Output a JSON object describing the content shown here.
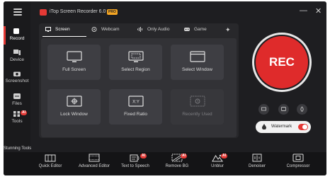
{
  "app": {
    "title": "iTop Screen Recorder 6.0",
    "badge": "PRO"
  },
  "window_controls": {
    "minimize": "—",
    "close": "✕"
  },
  "sidebar": {
    "items": [
      {
        "label": "Record",
        "icon": "record-icon",
        "active": true
      },
      {
        "label": "Device",
        "icon": "device-icon"
      },
      {
        "label": "Screenshot",
        "icon": "camera-icon"
      },
      {
        "label": "Files",
        "icon": "files-icon"
      },
      {
        "label": "Tools",
        "icon": "tools-icon",
        "badge": "AI"
      }
    ]
  },
  "tabs": [
    {
      "label": "Screen",
      "icon": "monitor-icon",
      "active": true
    },
    {
      "label": "Webcam",
      "icon": "webcam-icon"
    },
    {
      "label": "Only Audio",
      "icon": "audio-icon"
    },
    {
      "label": "Game",
      "icon": "gamepad-icon"
    }
  ],
  "modes": [
    {
      "label": "Full Screen",
      "icon": "full-screen-icon"
    },
    {
      "label": "Select Region",
      "icon": "select-region-icon"
    },
    {
      "label": "Select Window",
      "icon": "select-window-icon"
    },
    {
      "label": "Lock Window",
      "icon": "lock-window-icon"
    },
    {
      "label": "Fixed Ratio",
      "icon": "fixed-ratio-icon",
      "icon_text": "X:Y"
    },
    {
      "label": "Recently Used",
      "icon": "recently-used-icon",
      "disabled": true
    }
  ],
  "rec": {
    "label": "REC",
    "color": "#df2b2b"
  },
  "watermark": {
    "label": "Watermark",
    "enabled": true
  },
  "stunning_tools": {
    "label": "Stunning Tools",
    "items": [
      {
        "label": "Quick Editor",
        "icon": "quick-editor-icon"
      },
      {
        "label": "Advanced Editor",
        "icon": "advanced-editor-icon"
      },
      {
        "label": "Text to Speech",
        "icon": "text-to-speech-icon",
        "badge": "AI"
      },
      {
        "label": "Remove BG",
        "icon": "remove-bg-icon",
        "badge": "AI"
      },
      {
        "label": "Unblur",
        "icon": "unblur-icon",
        "badge": "AI"
      },
      {
        "label": "Denoiser",
        "icon": "denoiser-icon"
      },
      {
        "label": "Compressor",
        "icon": "compressor-icon"
      }
    ]
  },
  "colors": {
    "accent": "#e53935",
    "background": "#1e1e21",
    "panel": "#28282b"
  }
}
